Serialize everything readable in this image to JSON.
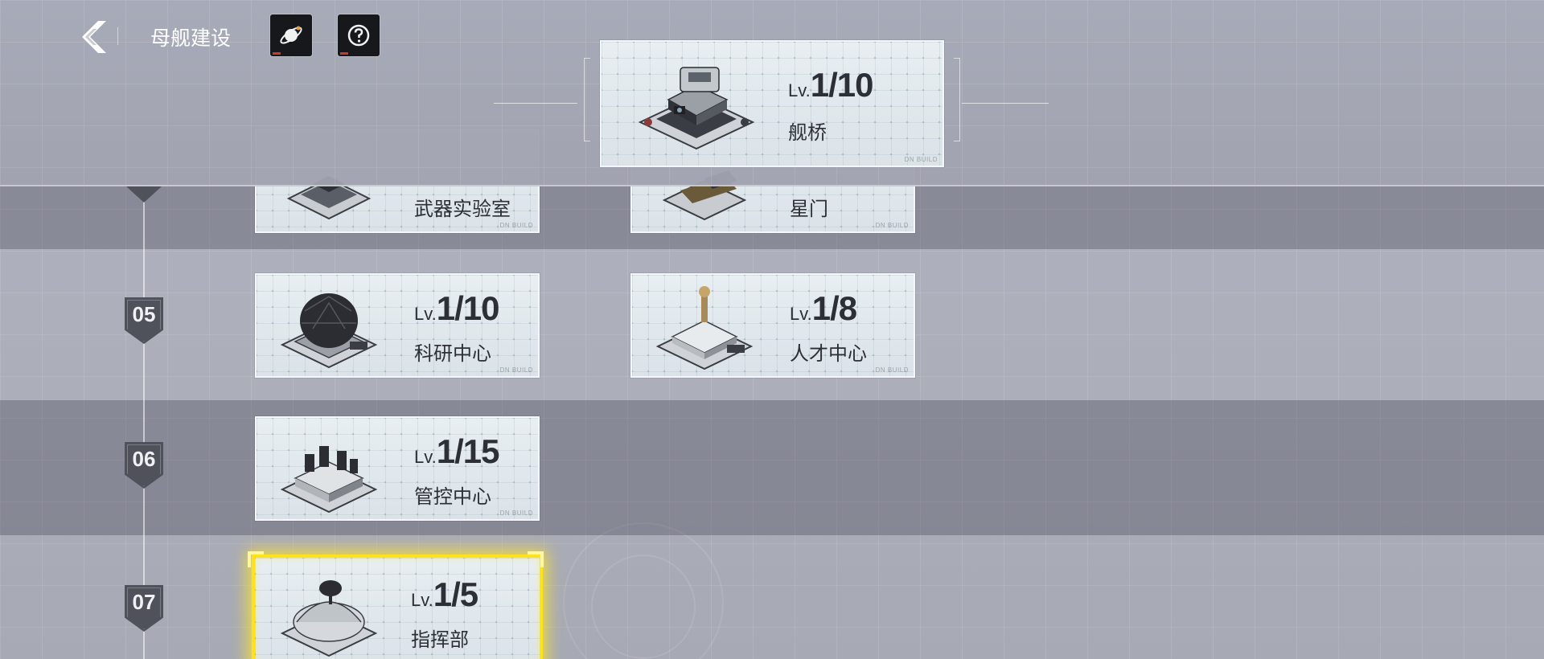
{
  "header": {
    "title": "母舰建设",
    "back_icon": "back-chevron-icon",
    "planet_icon": "planet-icon",
    "help_icon": "help-icon"
  },
  "bridge": {
    "level_prefix": "Lv.",
    "level": "1/10",
    "name": "舰桥"
  },
  "rows": [
    {
      "number": "",
      "cards": [
        {
          "level_prefix": "",
          "level": "",
          "name": "武器实验室"
        },
        {
          "level_prefix": "",
          "level": "",
          "name": "星门"
        }
      ]
    },
    {
      "number": "05",
      "cards": [
        {
          "level_prefix": "Lv.",
          "level": "1/10",
          "name": "科研中心"
        },
        {
          "level_prefix": "Lv.",
          "level": "1/8",
          "name": "人才中心"
        }
      ]
    },
    {
      "number": "06",
      "cards": [
        {
          "level_prefix": "Lv.",
          "level": "1/15",
          "name": "管控中心"
        }
      ]
    },
    {
      "number": "07",
      "cards": [
        {
          "level_prefix": "Lv.",
          "level": "1/5",
          "name": "指挥部"
        }
      ]
    }
  ],
  "card_watermark": "DN BUILD",
  "colors": {
    "highlight": "#ffe21a",
    "badge": "#50525b"
  }
}
